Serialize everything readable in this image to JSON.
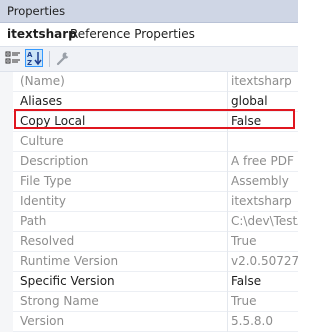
{
  "window": {
    "title": "Properties"
  },
  "object": {
    "name": "itextsharp",
    "type": "Reference Properties"
  },
  "toolbar": {
    "categorized_icon": "categorized-icon",
    "alphabetical_icon": "alphabetical-icon",
    "property_pages_icon": "wrench-icon"
  },
  "properties": [
    {
      "name": "(Name)",
      "value": "itextsharp",
      "editable": false
    },
    {
      "name": "Aliases",
      "value": "global",
      "editable": true
    },
    {
      "name": "Copy Local",
      "value": "False",
      "editable": true,
      "highlighted": true
    },
    {
      "name": "Culture",
      "value": "",
      "editable": false
    },
    {
      "name": "Description",
      "value": "A free PDF lib",
      "editable": false
    },
    {
      "name": "File Type",
      "value": "Assembly",
      "editable": false
    },
    {
      "name": "Identity",
      "value": "itextsharp",
      "editable": false
    },
    {
      "name": "Path",
      "value": "C:\\dev\\TestA",
      "editable": false
    },
    {
      "name": "Resolved",
      "value": "True",
      "editable": false
    },
    {
      "name": "Runtime Version",
      "value": "v2.0.50727",
      "editable": false
    },
    {
      "name": "Specific Version",
      "value": "False",
      "editable": true
    },
    {
      "name": "Strong Name",
      "value": "True",
      "editable": false
    },
    {
      "name": "Version",
      "value": "5.5.8.0",
      "editable": false
    }
  ],
  "colors": {
    "title_bar": "#cfd6e5",
    "highlight_outline": "#e0161f",
    "readonly_text": "#8d8d8d",
    "editable_text": "#1e1e1e",
    "active_button": "#3399ff"
  }
}
